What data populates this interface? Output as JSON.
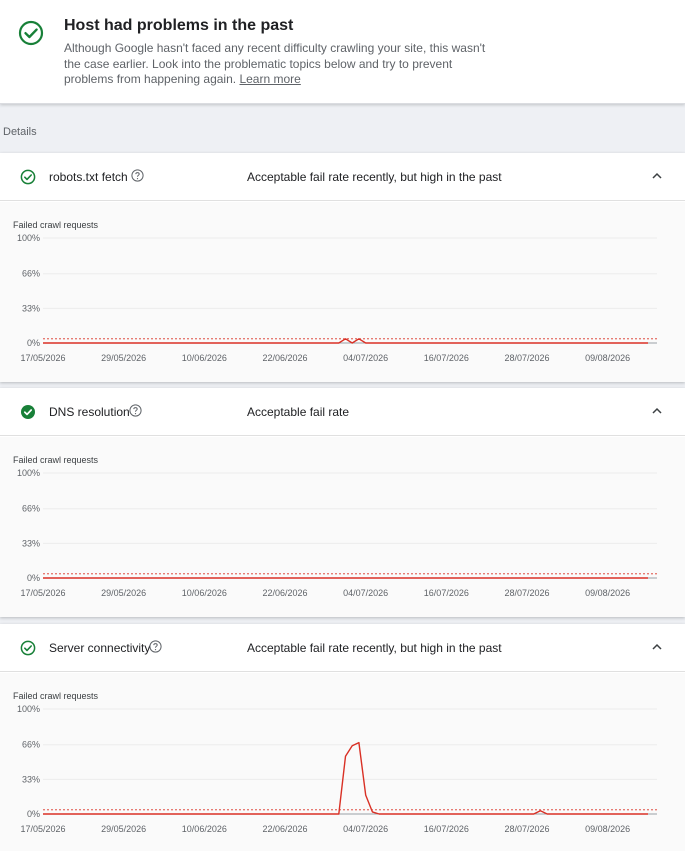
{
  "header": {
    "title": "Host had problems in the past",
    "description": "Although Google hasn't faced any recent difficulty crawling your site, this wasn't the case earlier. Look into the problematic topics below and try to prevent problems from happening again.",
    "learn_more": "Learn more",
    "accent": "#188038"
  },
  "details_label": "Details",
  "sections": [
    {
      "name": "robots.txt fetch",
      "status": "Acceptable fail rate recently, but high in the past",
      "icon": "check-circle-outline-icon",
      "chart_title": "Failed crawl requests"
    },
    {
      "name": "DNS resolution",
      "status": "Acceptable fail rate",
      "icon": "check-circle-filled-icon",
      "chart_title": "Failed crawl requests"
    },
    {
      "name": "Server connectivity",
      "status": "Acceptable fail rate recently, but high in the past",
      "icon": "check-circle-outline-icon",
      "chart_title": "Failed crawl requests"
    }
  ],
  "colors": {
    "line": "#d93025",
    "threshold": "#d93025",
    "ok_green": "#188038"
  },
  "chart_data": [
    {
      "type": "line",
      "ylabel": "Failed crawl requests",
      "ylim": [
        0,
        100
      ],
      "yticks": [
        "100%",
        "66%",
        "33%",
        "0%"
      ],
      "xticks": [
        "17/05/2026",
        "29/05/2026",
        "10/06/2026",
        "22/06/2026",
        "04/07/2026",
        "16/07/2026",
        "28/07/2026",
        "09/08/2026"
      ],
      "threshold": 4,
      "x": [
        "17/05/2026",
        "29/06/2026",
        "30/06/2026",
        "01/07/2026",
        "02/07/2026",
        "03/07/2026",
        "04/07/2026",
        "05/07/2026",
        "15/08/2026"
      ],
      "values": [
        0,
        0,
        0,
        4,
        0,
        4,
        0,
        0,
        0
      ]
    },
    {
      "type": "line",
      "ylabel": "Failed crawl requests",
      "ylim": [
        0,
        100
      ],
      "yticks": [
        "100%",
        "66%",
        "33%",
        "0%"
      ],
      "xticks": [
        "17/05/2026",
        "29/05/2026",
        "10/06/2026",
        "22/06/2026",
        "04/07/2026",
        "16/07/2026",
        "28/07/2026",
        "09/08/2026"
      ],
      "threshold": 4,
      "x": [
        "17/05/2026",
        "15/08/2026"
      ],
      "values": [
        0,
        0
      ]
    },
    {
      "type": "line",
      "ylabel": "Failed crawl requests",
      "ylim": [
        0,
        100
      ],
      "yticks": [
        "100%",
        "66%",
        "33%",
        "0%"
      ],
      "xticks": [
        "17/05/2026",
        "29/05/2026",
        "10/06/2026",
        "22/06/2026",
        "04/07/2026",
        "16/07/2026",
        "28/07/2026",
        "09/08/2026"
      ],
      "threshold": 4,
      "x": [
        "17/05/2026",
        "26/06/2026",
        "30/06/2026",
        "01/07/2026",
        "02/07/2026",
        "03/07/2026",
        "04/07/2026",
        "05/07/2026",
        "06/07/2026",
        "29/07/2026",
        "30/07/2026",
        "31/07/2026",
        "01/08/2026",
        "15/08/2026"
      ],
      "values": [
        0,
        0,
        0,
        55,
        65,
        68,
        18,
        2,
        0,
        0,
        3,
        0,
        0,
        0
      ]
    }
  ]
}
